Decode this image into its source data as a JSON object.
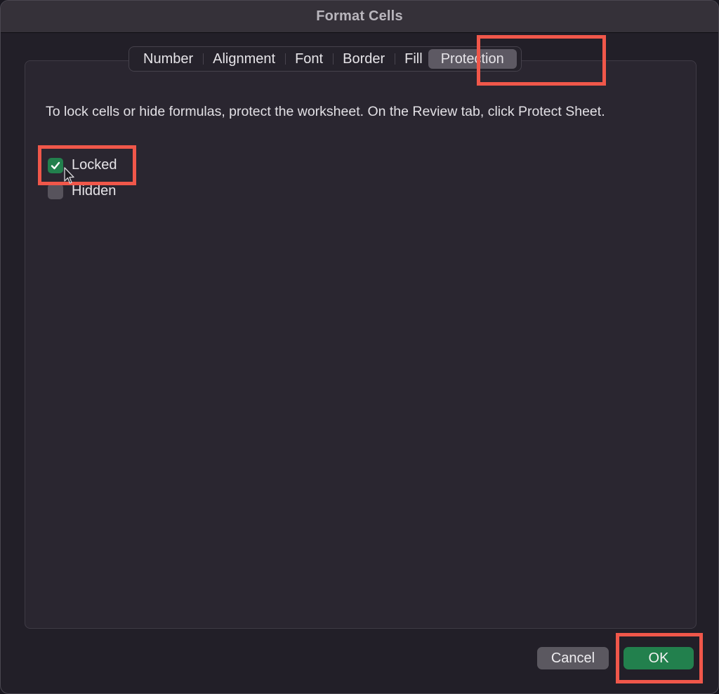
{
  "window": {
    "title": "Format Cells"
  },
  "tabs": [
    {
      "label": "Number",
      "active": false
    },
    {
      "label": "Alignment",
      "active": false
    },
    {
      "label": "Font",
      "active": false
    },
    {
      "label": "Border",
      "active": false
    },
    {
      "label": "Fill",
      "active": false
    },
    {
      "label": "Protection",
      "active": true
    }
  ],
  "protection": {
    "description": "To lock cells or hide formulas, protect the worksheet. On the Review tab, click Protect Sheet.",
    "options": [
      {
        "label": "Locked",
        "checked": true
      },
      {
        "label": "Hidden",
        "checked": false
      }
    ]
  },
  "buttons": {
    "cancel": "Cancel",
    "ok": "OK"
  },
  "colors": {
    "accent_green": "#22804d",
    "highlight_red": "#f0574a"
  }
}
